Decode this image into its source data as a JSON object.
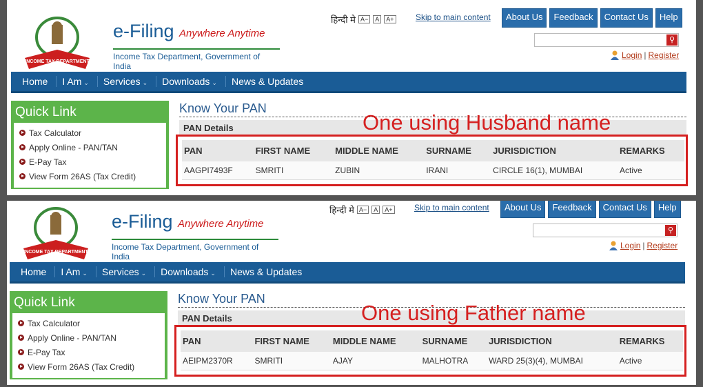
{
  "header": {
    "title": "e-Filing",
    "tagline": "Anywhere Anytime",
    "department": "Income Tax Department, Government of India",
    "emblem_text": "INCOME TAX DEPARTMENT",
    "hindi_label": "हिन्दी मे",
    "font_buttons": [
      "A−",
      "A",
      "A+"
    ],
    "skip_link": "Skip to main content",
    "top_links": [
      "About Us",
      "Feedback",
      "Contact Us",
      "Help"
    ],
    "search_placeholder": "",
    "login": "Login",
    "separator": "|",
    "register": "Register"
  },
  "nav": [
    "Home",
    "I Am",
    "Services",
    "Downloads",
    "News & Updates"
  ],
  "quick_link": {
    "title": "Quick Link",
    "items": [
      "Tax Calculator",
      "Apply Online - PAN/TAN",
      "E-Pay Tax",
      "View Form 26AS (Tax Credit)"
    ]
  },
  "content": {
    "heading": "Know Your PAN",
    "pan_details": "PAN Details",
    "columns": [
      "PAN",
      "FIRST NAME",
      "MIDDLE NAME",
      "SURNAME",
      "JURISDICTION",
      "REMARKS"
    ]
  },
  "panels": [
    {
      "annotation": "One using Husband name",
      "row": {
        "pan": "AAGPI7493F",
        "first": "SMRITI",
        "middle": "ZUBIN",
        "surname": "IRANI",
        "jurisdiction": "CIRCLE 16(1), MUMBAI",
        "remarks": "Active"
      }
    },
    {
      "annotation": "One using Father name",
      "row": {
        "pan": "AEIPM2370R",
        "first": "SMRITI",
        "middle": "AJAY",
        "surname": "MALHOTRA",
        "jurisdiction": "WARD 25(3)(4), MUMBAI",
        "remarks": "Active"
      }
    }
  ],
  "colors": {
    "brand_blue": "#1a5c96",
    "quick_link_green": "#5cb44a",
    "annotation_red": "#d52020"
  }
}
